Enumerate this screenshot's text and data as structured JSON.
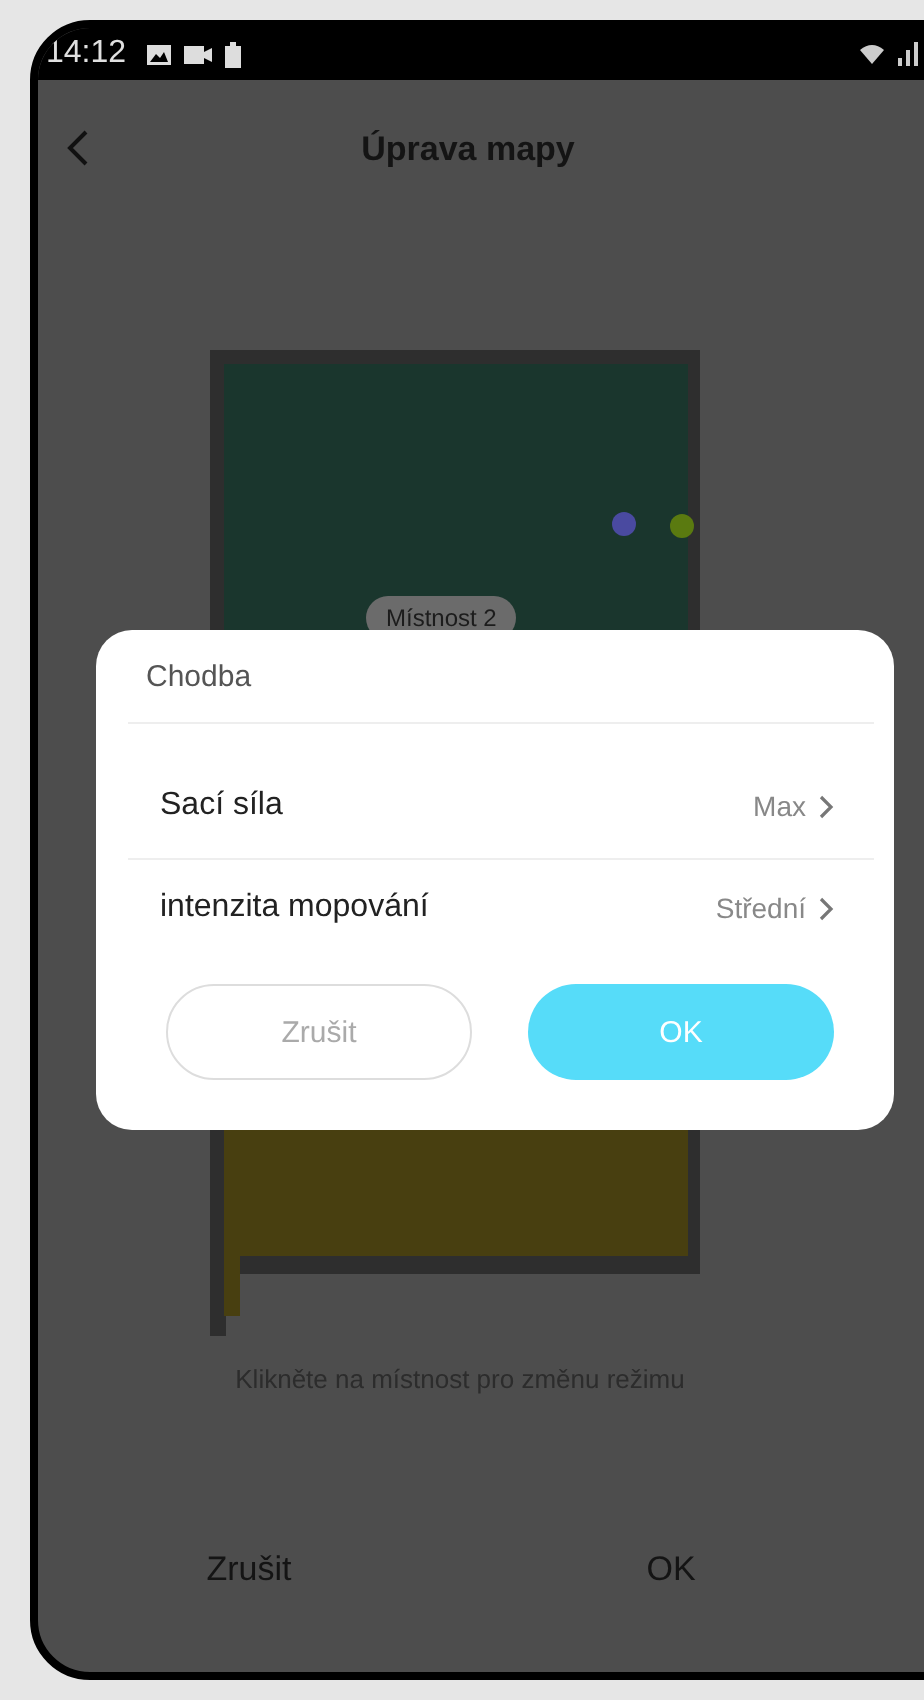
{
  "status_bar": {
    "time": "14:12"
  },
  "header": {
    "title": "Úprava mapy"
  },
  "map": {
    "rooms": [
      {
        "name": "Místnost 2",
        "color": "#1a362d"
      },
      {
        "color": "#483f10"
      }
    ]
  },
  "hint": "Klikněte na místnost pro změnu režimu",
  "bottom_bar": {
    "cancel": "Zrušit",
    "ok": "OK"
  },
  "dialog": {
    "title": "Chodba",
    "settings": [
      {
        "label": "Sací síla",
        "value": "Max"
      },
      {
        "label": "intenzita mopování",
        "value": "Střední"
      }
    ],
    "cancel": "Zrušit",
    "ok": "OK"
  }
}
